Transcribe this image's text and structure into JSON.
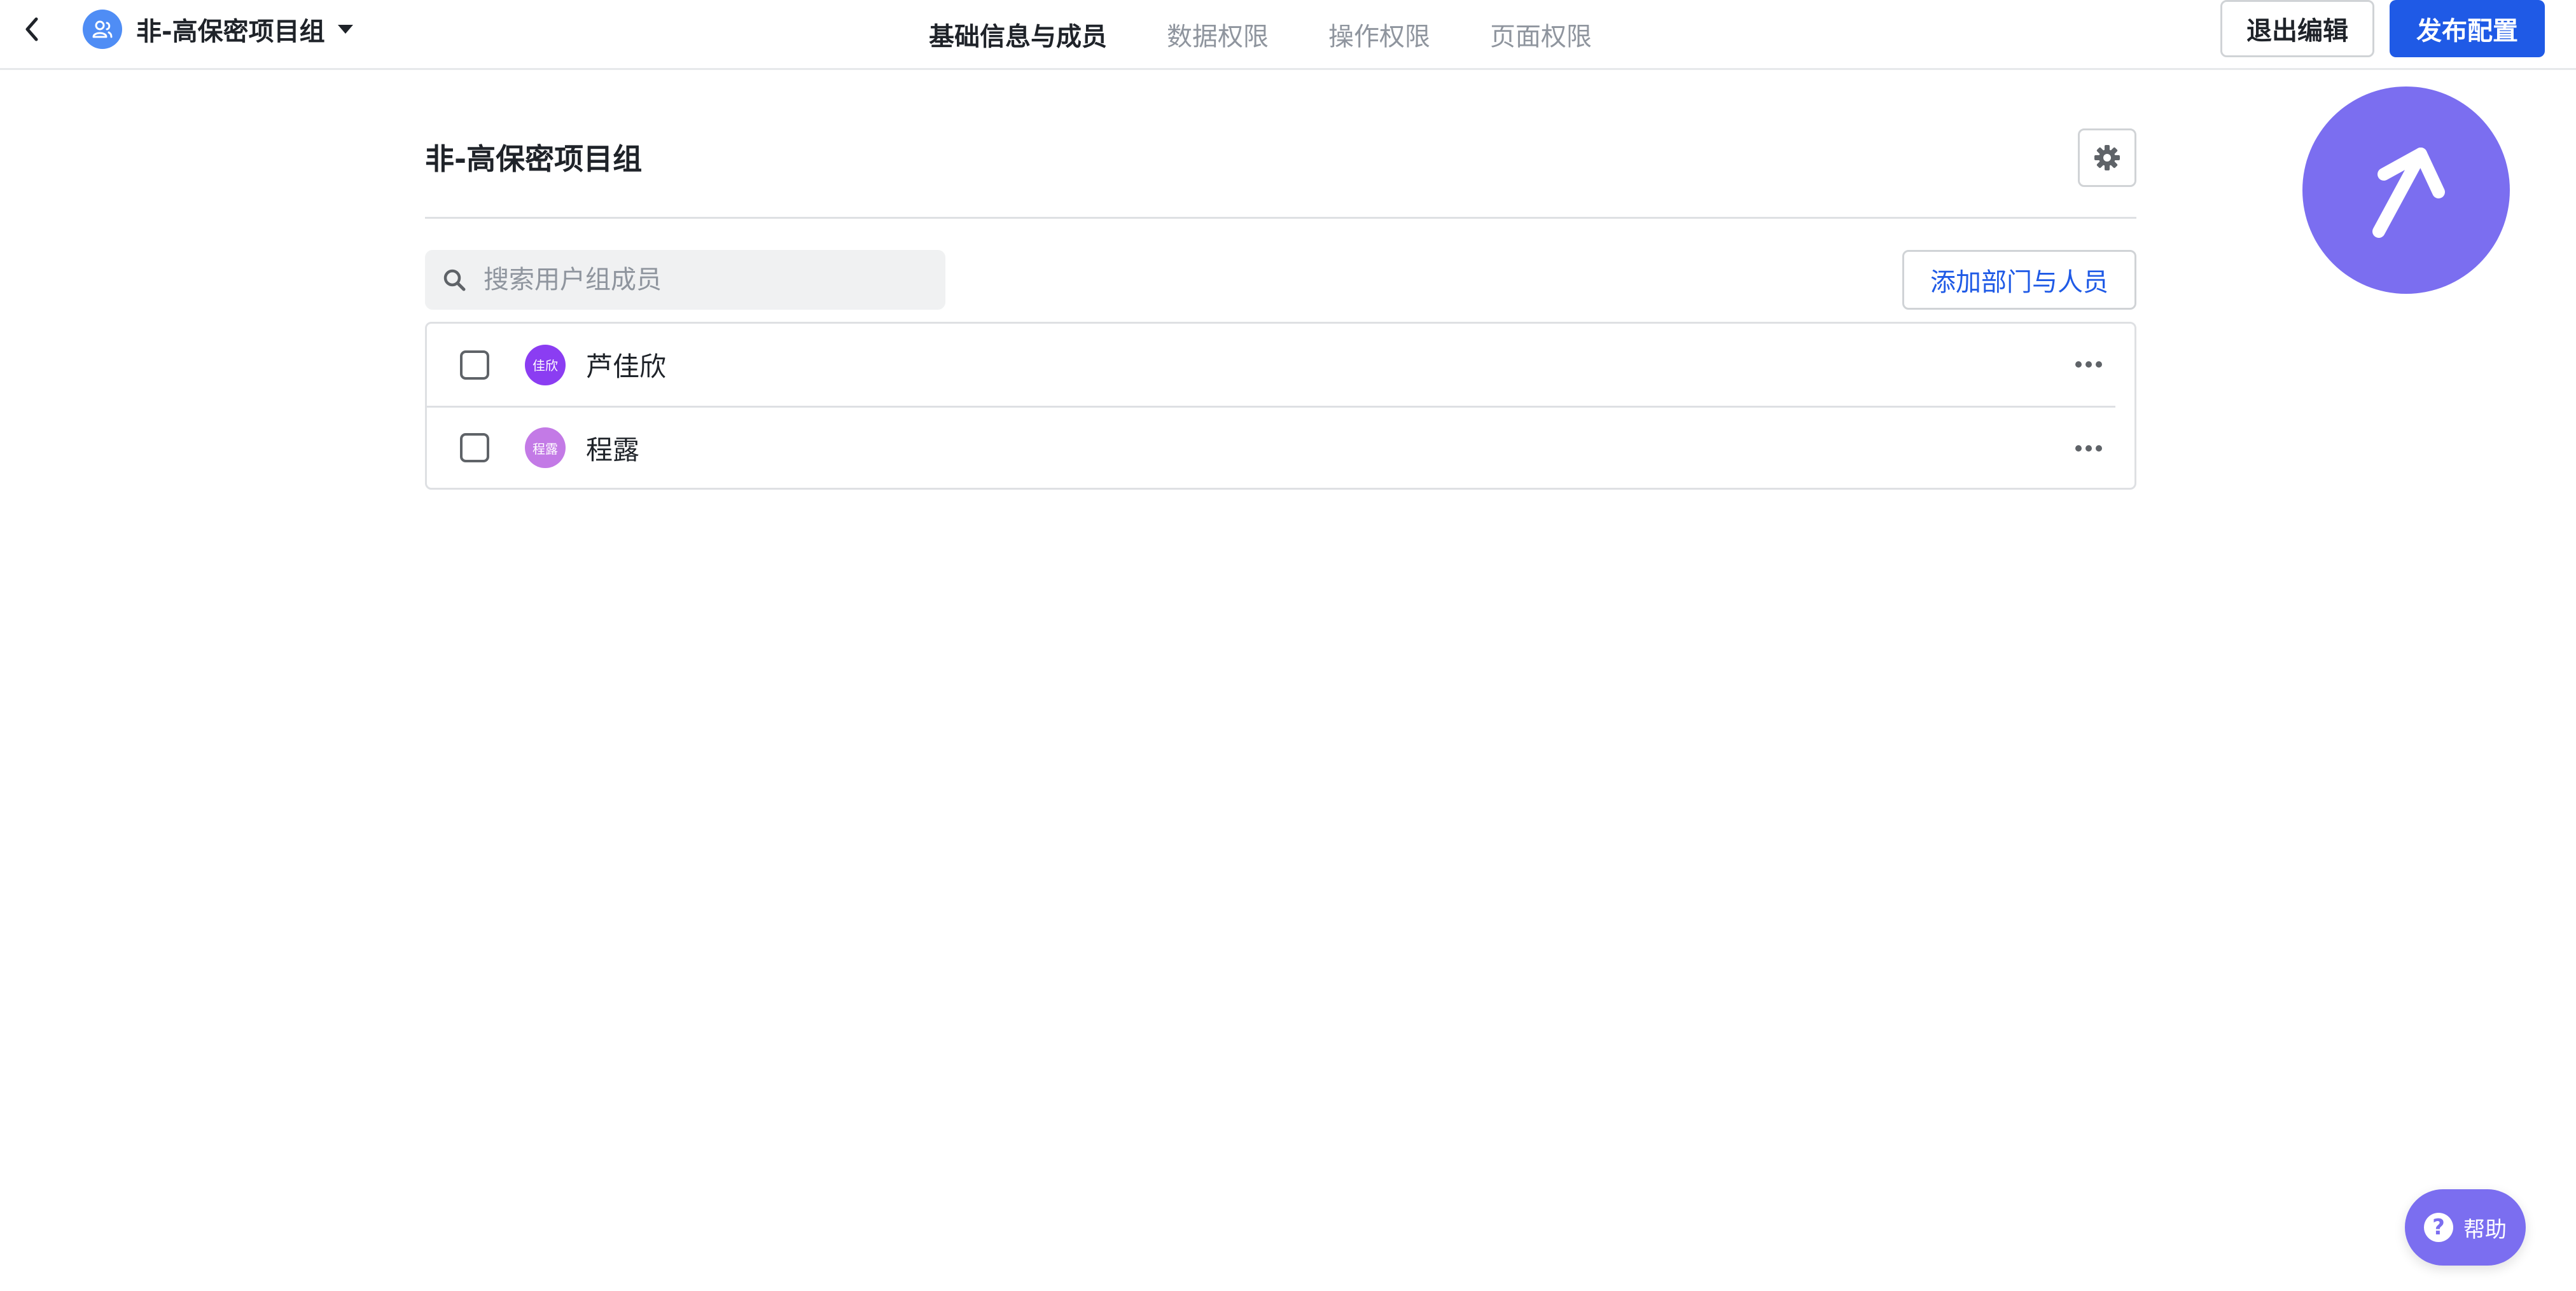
{
  "header": {
    "group_name": "非-高保密项目组",
    "tabs": [
      {
        "label": "基础信息与成员",
        "active": true
      },
      {
        "label": "数据权限",
        "active": false
      },
      {
        "label": "操作权限",
        "active": false
      },
      {
        "label": "页面权限",
        "active": false
      }
    ],
    "exit_label": "退出编辑",
    "publish_label": "发布配置"
  },
  "main": {
    "title": "非-高保密项目组",
    "search": {
      "placeholder": "搜索用户组成员",
      "value": ""
    },
    "add_label": "添加部门与人员",
    "members": [
      {
        "name": "芦佳欣",
        "avatar_text": "佳欣",
        "avatar_color": "#8b3df2",
        "checked": false
      },
      {
        "name": "程露",
        "avatar_text": "程露",
        "avatar_color": "#c37ae6",
        "checked": false
      }
    ]
  },
  "help": {
    "label": "帮助"
  },
  "colors": {
    "primary": "#1f5ae6",
    "accent_purple": "#7b6ef0",
    "group_avatar": "#4f8df5"
  },
  "icons": {
    "back": "chevron-left-icon",
    "group": "user-group-icon",
    "settings": "gear-icon",
    "search": "search-icon",
    "more": "more-horizontal-icon",
    "fab": "arrow-up-right-icon",
    "help": "question-icon"
  }
}
